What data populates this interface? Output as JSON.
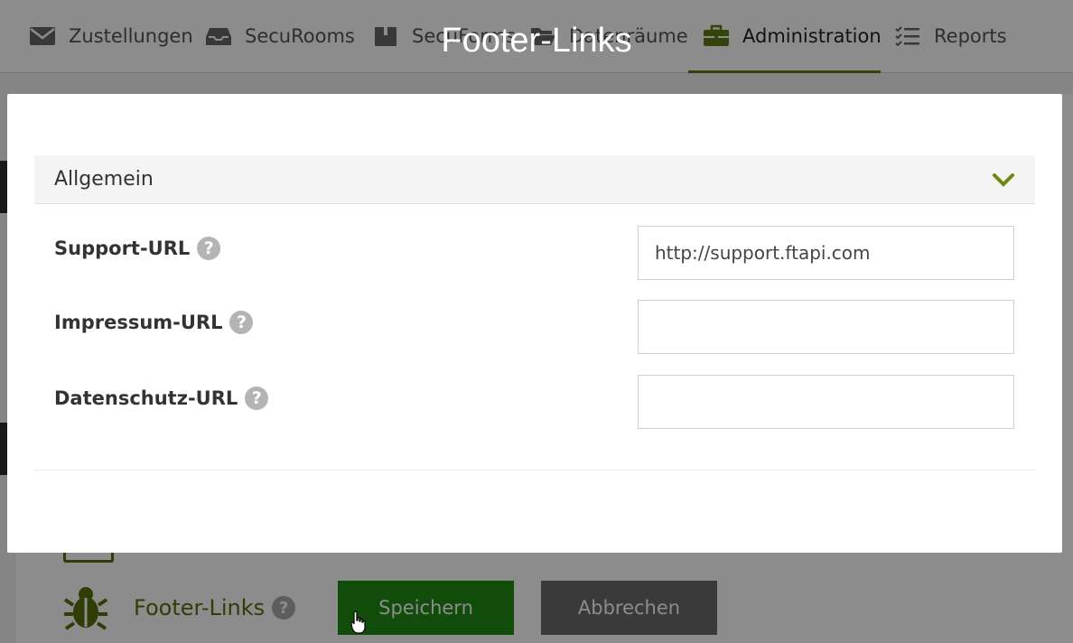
{
  "nav": {
    "items": [
      {
        "label": "Zustellungen",
        "icon": "envelope-icon"
      },
      {
        "label": "SecuRooms",
        "icon": "inbox-icon"
      },
      {
        "label": "SecuForms",
        "icon": "box-icon"
      },
      {
        "label": "Datenräume",
        "icon": "folder-open-icon"
      },
      {
        "label": "Administration",
        "icon": "briefcase-icon",
        "active": true
      },
      {
        "label": "Reports",
        "icon": "checklist-icon"
      }
    ]
  },
  "background": {
    "footer_links_label": "Footer-Links",
    "help_glyph": "?",
    "save_label": "Speichern",
    "cancel_label": "Abbrechen"
  },
  "modal": {
    "title": "Footer-Links",
    "section_title": "Allgemein",
    "fields": [
      {
        "label": "Support-URL",
        "value": "http://support.ftapi.com"
      },
      {
        "label": "Impressum-URL",
        "value": ""
      },
      {
        "label": "Datenschutz-URL",
        "value": ""
      }
    ],
    "help_glyph": "?"
  },
  "colors": {
    "accent": "#5f7a12",
    "save": "#208b14",
    "cancel": "#6b6b6b"
  }
}
